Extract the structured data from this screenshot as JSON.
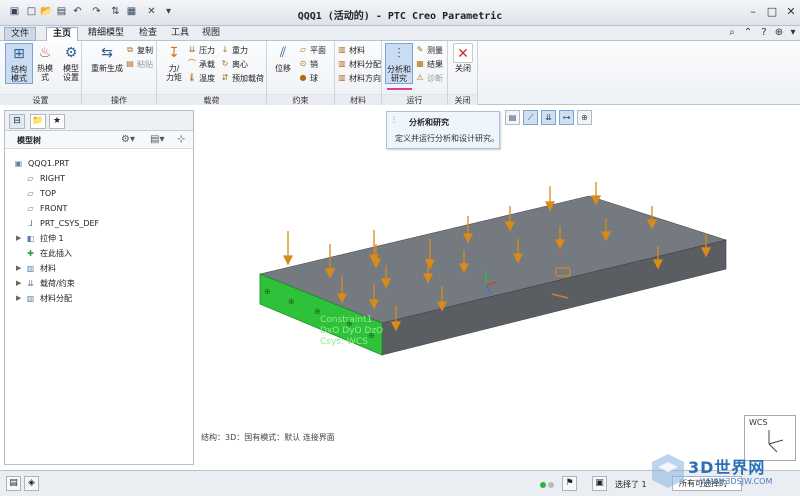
{
  "titlebar": {
    "title": "QQQ1 (活动的) - PTC Creo Parametric"
  },
  "menubar": {
    "tabs": [
      "文件",
      "主页",
      "精细模型",
      "检查",
      "工具",
      "视图"
    ],
    "active": "主页"
  },
  "ribbon": {
    "settings": {
      "label": "设置",
      "b1": "结构\n模式",
      "b2": "热模\n式",
      "b3": "模型\n设置"
    },
    "operations": {
      "label": "操作",
      "regen": "重新生成",
      "copy": "复制",
      "paste": "粘贴"
    },
    "loads": {
      "label": "载荷",
      "force": "力/\n力矩",
      "pressure": "压力",
      "bearing": "承载",
      "temperature": "温度",
      "gravity": "重力",
      "centrifugal": "离心",
      "preload": "预加载荷"
    },
    "constraints": {
      "label": "约束",
      "displacement": "位移",
      "plane": "平面",
      "pin": "销",
      "ball": "球"
    },
    "materials": {
      "label": "材料",
      "material": "材料",
      "assign": "材料分配",
      "orient": "材料方向"
    },
    "run": {
      "label": "运行",
      "analysis": "分析和\n研究",
      "measure": "测量",
      "results": "结果",
      "diagnose": "诊断"
    },
    "close": {
      "label": "关闭",
      "close": "关闭"
    }
  },
  "tooltip": {
    "title": "分析和研究",
    "desc": "定义并运行分析和设计研究。"
  },
  "tree": {
    "header": "模型树",
    "nodes": [
      {
        "label": "QQQ1.PRT",
        "icon": "part-icon"
      },
      {
        "label": "RIGHT",
        "icon": "datum-plane-icon"
      },
      {
        "label": "TOP",
        "icon": "datum-plane-icon"
      },
      {
        "label": "FRONT",
        "icon": "datum-plane-icon"
      },
      {
        "label": "PRT_CSYS_DEF",
        "icon": "csys-icon"
      },
      {
        "label": "拉伸 1",
        "icon": "extrude-icon"
      },
      {
        "label": "在此插入",
        "icon": "insert-here-icon"
      },
      {
        "label": "材料",
        "icon": "material-icon"
      },
      {
        "label": "载荷/约束",
        "icon": "loads-icon"
      },
      {
        "label": "材料分配",
        "icon": "material-assign-icon"
      }
    ]
  },
  "viewport": {
    "constraint_label": [
      "Constraint1",
      "DxO DyO DzO",
      "Csys: WCS"
    ],
    "status": "结构：3D：国有模式：默认 连接界面",
    "wcs": "WCS"
  },
  "statusbar": {
    "select_label": "选择了 1",
    "filter": "所有可选择的"
  },
  "watermark": {
    "text": "3D世界网",
    "url": "WWW.3DSJW.COM"
  },
  "colors": {
    "plate_top": "#757a80",
    "plate_side": "#5a5e63",
    "selected_face": "#2fc13a",
    "arrow": "#d98a18",
    "accent": "#2d5f8e"
  }
}
